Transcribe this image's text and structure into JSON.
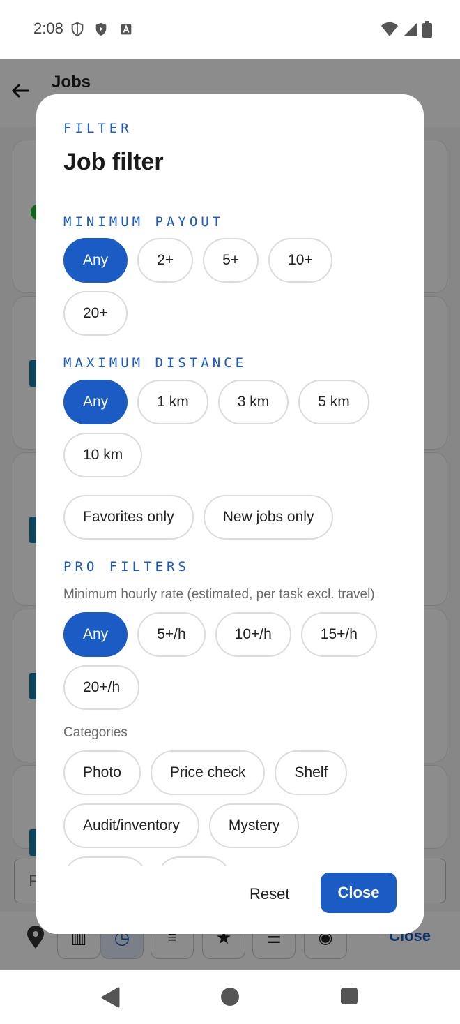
{
  "status_bar": {
    "time": "2:08"
  },
  "background": {
    "app_title": "Jobs",
    "search_placeholder_partial": "F",
    "close_label": "Close"
  },
  "dialog": {
    "overline": "FILTER",
    "title": "Job filter",
    "min_payout": {
      "label": "MINIMUM PAYOUT",
      "options": [
        "Any",
        "2+",
        "5+",
        "10+",
        "20+"
      ],
      "selected": "Any"
    },
    "max_distance": {
      "label": "MAXIMUM DISTANCE",
      "options": [
        "Any",
        "1 km",
        "3 km",
        "5 km",
        "10 km"
      ],
      "selected": "Any"
    },
    "toggles": [
      "Favorites only",
      "New jobs only"
    ],
    "pro_filters": {
      "label": "PRO FILTERS",
      "hourly_rate_label": "Minimum hourly rate (estimated, per task excl. travel)",
      "hourly_options": [
        "Any",
        "5+/h",
        "10+/h",
        "15+/h",
        "20+/h"
      ],
      "selected": "Any",
      "categories_label": "Categories",
      "categories": [
        "Photo",
        "Price check",
        "Shelf",
        "Audit/inventory",
        "Mystery"
      ]
    },
    "actions": {
      "reset": "Reset",
      "close": "Close"
    }
  }
}
